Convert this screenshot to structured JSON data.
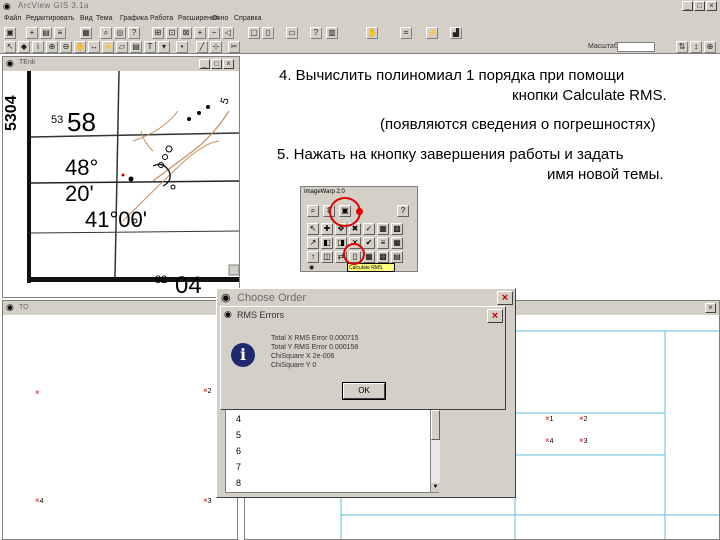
{
  "app": {
    "title": "ArcView GIS 3.1a",
    "icon": "globe-icon",
    "window_controls": [
      "_",
      "□",
      "×"
    ]
  },
  "menu": [
    "Файл",
    "Редактировать",
    "Вид",
    "Тема",
    "Графика",
    "Работа",
    "Расширения",
    "Окно",
    "Справка"
  ],
  "toolbar": {
    "scale_label": "Масштаб 1:",
    "scale_value": ""
  },
  "map_view": {
    "title": "TEnk",
    "labels": {
      "top_left": "5304",
      "superscript": "53",
      "minute_58": "58",
      "deg_48": "48°",
      "min_20": "20'",
      "coord": "41°00'",
      "bottom_super": "82",
      "bottom_04": "04",
      "top_right": "5"
    }
  },
  "instructions": {
    "step4_line1": "4.  Вычислить полиномиал 1 порядка при помощи",
    "step4_line2": "кнопки  Calculate RMS.",
    "step4_line3": "(появляются сведения о погрешностях)",
    "step5_line1": "5.  Нажать на кнопку завершения работы и задать",
    "step5_line2": "имя новой темы."
  },
  "imagewarp": {
    "title": "ImageWarp 2.0",
    "tooltip": "Calculate RMS",
    "accent": "#e00000"
  },
  "view_t": {
    "title": "TO",
    "point_labels": [
      "2",
      "4",
      "3"
    ]
  },
  "view_right": {
    "point_labels": [
      "1",
      "2",
      "4",
      "3"
    ]
  },
  "choose_order": {
    "title": "Choose Order",
    "list": [
      "4",
      "5",
      "6",
      "7",
      "8"
    ]
  },
  "rms_errors": {
    "title": "RMS Errors",
    "icon": "info-icon",
    "lines": [
      "Total X RMS Error 0.000715",
      "Total Y RMS Error 0.000158",
      "ChiSquare X 2e-006",
      "ChiSquare Y 0"
    ],
    "ok_label": "OK"
  }
}
